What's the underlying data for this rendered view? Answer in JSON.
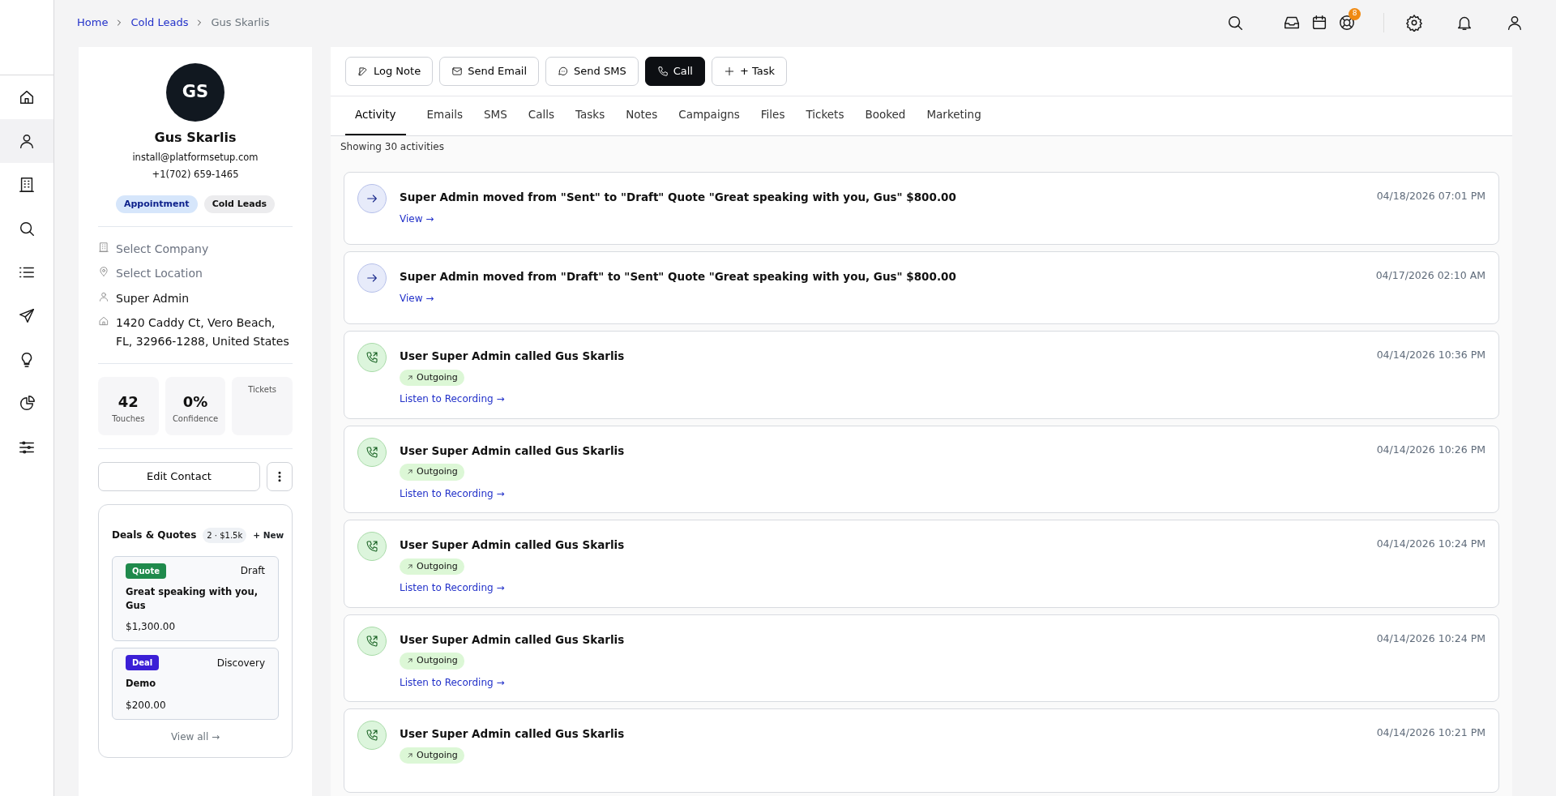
{
  "rail": [
    {
      "selected": false
    },
    {
      "selected": true
    },
    {
      "selected": false
    },
    {
      "selected": false
    },
    {
      "selected": false
    },
    {
      "selected": false
    },
    {
      "selected": false
    },
    {
      "selected": false
    },
    {
      "selected": false
    }
  ],
  "breadcrumb": [
    {
      "label": "Home",
      "link": true
    },
    {
      "label": "Cold Leads",
      "link": true
    },
    {
      "label": "Gus Skarlis",
      "link": false
    }
  ],
  "top_bar": {
    "support_badge": "8"
  },
  "contact": {
    "initials": "GS",
    "name": "Gus Skarlis",
    "email": "install@platformsetup.com",
    "phone": "+1(702) 659-1465",
    "tags": [
      {
        "label": "Appointment",
        "color": "#d6e6fb"
      },
      {
        "label": "Cold Leads",
        "color": "#ececee"
      }
    ],
    "fields": [
      {
        "text": "Select Company",
        "placeholder": true
      },
      {
        "text": "Select Location",
        "placeholder": true
      },
      {
        "text": "Super Admin",
        "placeholder": false
      },
      {
        "text": "1420 Caddy Ct, Vero Beach, FL, 32966-1288, United States",
        "placeholder": false
      }
    ],
    "stats": [
      {
        "value": "42",
        "label": "Touches"
      },
      {
        "value": "0%",
        "label": "Confidence"
      },
      {
        "label": "Tickets"
      }
    ],
    "edit_button": "Edit Contact",
    "deals": {
      "title": "Deals & Quotes",
      "summary": "2 · $1.5k",
      "new": "+ New",
      "items": [
        {
          "type": "Quote",
          "color": "#1f8a4c",
          "stage": "Draft",
          "name": "Great speaking with you, Gus",
          "amount": "$1,300.00"
        },
        {
          "type": "Deal",
          "color": "#3b1fd6",
          "stage": "Discovery",
          "name": "Demo",
          "amount": "$200.00"
        }
      ],
      "view_all": "View all →"
    }
  },
  "actions": [
    {
      "label": "Log Note",
      "kind": "outline"
    },
    {
      "label": "Send Email",
      "kind": "outline"
    },
    {
      "label": "Send SMS",
      "kind": "outline"
    },
    {
      "label": "Call",
      "kind": "dark"
    },
    {
      "label": "+ Task",
      "kind": "outline"
    }
  ],
  "tabs": [
    {
      "label": "Activity",
      "selected": true
    },
    {
      "label": "Emails",
      "selected": false
    },
    {
      "label": "SMS",
      "selected": false
    },
    {
      "label": "Calls",
      "selected": false
    },
    {
      "label": "Tasks",
      "selected": false
    },
    {
      "label": "Notes",
      "selected": false
    },
    {
      "label": "Campaigns",
      "selected": false
    },
    {
      "label": "Files",
      "selected": false
    },
    {
      "label": "Tickets",
      "selected": false
    },
    {
      "label": "Booked",
      "selected": false
    },
    {
      "label": "Marketing",
      "selected": false
    }
  ],
  "showing": "Showing 30 activities",
  "activities": [
    {
      "kind": "stage",
      "title": "Super Admin moved from \"Sent\" to \"Draft\" Quote \"Great speaking with you, Gus\" $800.00",
      "time": "04/18/2026 07:01 PM",
      "link": "View →"
    },
    {
      "kind": "stage",
      "title": "Super Admin moved from \"Draft\" to \"Sent\" Quote \"Great speaking with you, Gus\" $800.00",
      "time": "04/17/2026 02:10 AM",
      "link": "View →"
    },
    {
      "kind": "call",
      "title": "User Super Admin called Gus Skarlis",
      "time": "04/14/2026 10:36 PM",
      "direction": "Outgoing",
      "link": "Listen to Recording →"
    },
    {
      "kind": "call",
      "title": "User Super Admin called Gus Skarlis",
      "time": "04/14/2026 10:26 PM",
      "direction": "Outgoing",
      "link": "Listen to Recording →"
    },
    {
      "kind": "call",
      "title": "User Super Admin called Gus Skarlis",
      "time": "04/14/2026 10:24 PM",
      "direction": "Outgoing",
      "link": "Listen to Recording →"
    },
    {
      "kind": "call",
      "title": "User Super Admin called Gus Skarlis",
      "time": "04/14/2026 10:24 PM",
      "direction": "Outgoing",
      "link": "Listen to Recording →"
    },
    {
      "kind": "call",
      "title": "User Super Admin called Gus Skarlis",
      "time": "04/14/2026 10:21 PM",
      "direction": "Outgoing"
    }
  ]
}
